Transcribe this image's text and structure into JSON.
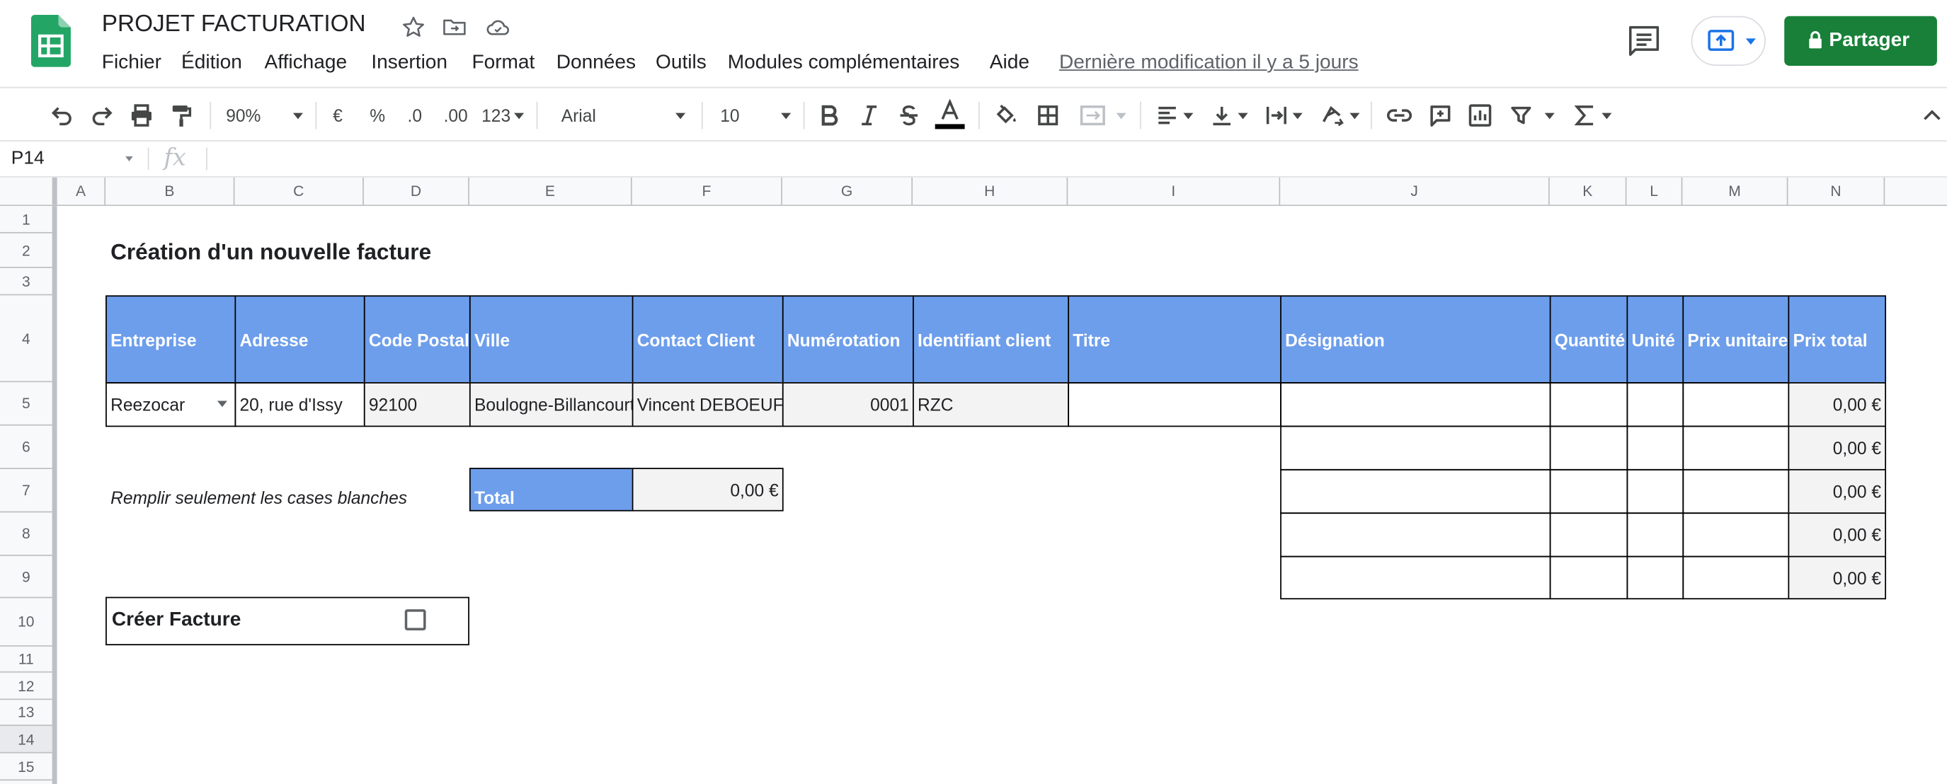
{
  "app": {
    "doc_title": "PROJET FACTURATION",
    "last_modified": "Dernière modification il y a 5 jours",
    "share_label": "Partager",
    "brand_green": "#188038",
    "header_blue": "#6d9eeb"
  },
  "menu": [
    "Fichier",
    "Édition",
    "Affichage",
    "Insertion",
    "Format",
    "Données",
    "Outils",
    "Modules complémentaires",
    "Aide"
  ],
  "toolbar": {
    "zoom": "90%",
    "currency": "€",
    "percent": "%",
    "dec_decrease": ".0",
    "dec_increase": ".00",
    "number_format": "123",
    "font": "Arial",
    "font_size": "10"
  },
  "formula_bar": {
    "cell_ref": "P14",
    "fx": "fx"
  },
  "columns": [
    "A",
    "B",
    "C",
    "D",
    "E",
    "F",
    "G",
    "H",
    "I",
    "J",
    "K",
    "L",
    "M",
    "N"
  ],
  "rows": [
    "1",
    "2",
    "3",
    "4",
    "5",
    "6",
    "7",
    "8",
    "9",
    "10",
    "11",
    "12",
    "13",
    "14",
    "15"
  ],
  "sheet": {
    "title": "Création d'un nouvelle facture",
    "headers": {
      "entreprise": "Entreprise",
      "adresse": "Adresse",
      "code_postal": "Code Postal",
      "ville": "Ville",
      "contact": "Contact Client",
      "numerotation": "Numérotation",
      "identifiant": "Identifiant client",
      "titre": "Titre",
      "designation": "Désignation",
      "quantite": "Quantité",
      "unite": "Unité",
      "prix_unitaire": "Prix unitaire",
      "prix_total": "Prix total"
    },
    "row5": {
      "entreprise": "Reezocar",
      "adresse": "20, rue d'Issy",
      "code_postal": "92100",
      "ville": "Boulogne-Billancourt",
      "contact": "Vincent DEBOEUF",
      "numerotation": "0001",
      "identifiant": "RZC",
      "titre": ""
    },
    "line_totals": [
      "0,00 €",
      "0,00 €",
      "0,00 €",
      "0,00 €",
      "0,00 €"
    ],
    "note": "Remplir seulement les cases blanches",
    "total_label": "Total",
    "total_value": "0,00 €",
    "create_label": "Créer Facture"
  }
}
